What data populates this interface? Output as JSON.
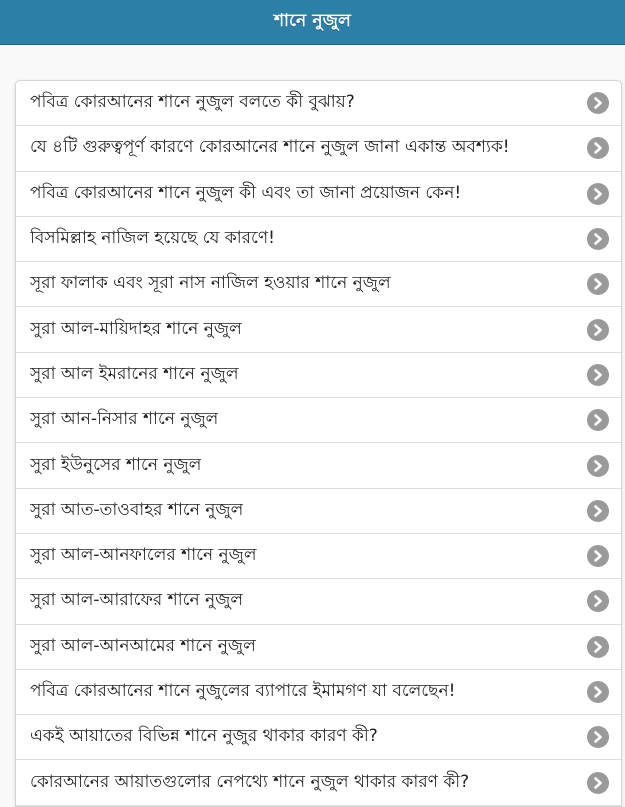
{
  "header": {
    "title": "শানে নুজুল"
  },
  "colors": {
    "header_bg": "#2c7fa6",
    "chevron_bg": "#9a9a9a"
  },
  "list": {
    "chevron_icon": "chevron-right-circle-icon",
    "items": [
      {
        "label": "পবিত্র কোরআনের শানে নুজুল বলতে কী বুঝায়?"
      },
      {
        "label": "যে ৪টি গুরুত্বপূর্ণ কারণে কোরআনের শানে নুজুল জানা একান্ত অবশ্যক!"
      },
      {
        "label": "পবিত্র কোরআনের শানে নুজুল কী এবং তা জানা প্রয়োজন কেন!"
      },
      {
        "label": "বিসমিল্লাহ নাজিল হয়েছে যে কারণে!"
      },
      {
        "label": "সূরা ফালাক এবং সূরা নাস নাজিল হওয়ার শানে নুজুল"
      },
      {
        "label": "সুরা আল-মায়িদাহর শানে নুজুল"
      },
      {
        "label": "সুরা আল ইমরানের শানে নুজুল"
      },
      {
        "label": "সুরা আন-নিসার শানে নুজুল"
      },
      {
        "label": "সুরা ইউনুসের শানে নুজুল"
      },
      {
        "label": "সুরা আত-তাওবাহর শানে নুজুল"
      },
      {
        "label": "সুরা আল-আনফালের শানে নুজুল"
      },
      {
        "label": "সুরা আল-আরাফের শানে নুজুল"
      },
      {
        "label": "সুরা আল-আনআমের শানে নুজুল"
      },
      {
        "label": "পবিত্র কোরআনের শানে নুজুলের ব্যাপারে ইমামগণ যা বলেছেন!"
      },
      {
        "label": "একই আয়াতের বিভিন্ন শানে নুজুর থাকার কারণ কী?"
      },
      {
        "label": "কোরআনের আয়াতগুলোর নেপথ্যে শানে নুজুল থাকার কারণ কী?"
      }
    ]
  }
}
